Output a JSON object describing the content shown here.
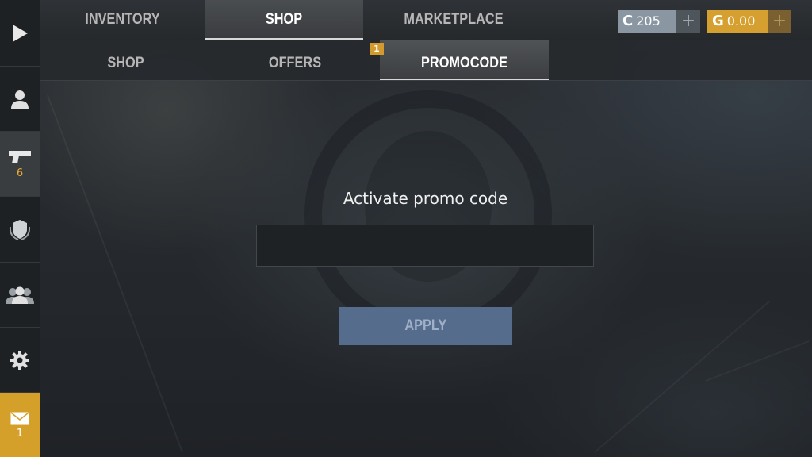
{
  "top_tabs": [
    {
      "label": "INVENTORY",
      "active": false
    },
    {
      "label": "SHOP",
      "active": true
    },
    {
      "label": "MARKETPLACE",
      "active": false
    }
  ],
  "sub_tabs": [
    {
      "label": "SHOP",
      "active": false
    },
    {
      "label": "OFFERS",
      "active": false,
      "badge": "1"
    },
    {
      "label": "PROMOCODE",
      "active": true
    }
  ],
  "currency": {
    "silver": {
      "icon": "C",
      "value": "205",
      "plus": "+"
    },
    "gold": {
      "icon": "G",
      "value": "0.00",
      "plus": "+"
    }
  },
  "sidebar": {
    "items": [
      {
        "icon": "play-icon"
      },
      {
        "icon": "profile-icon"
      },
      {
        "icon": "pistol-icon",
        "count": "6"
      },
      {
        "icon": "clan-shield-icon"
      },
      {
        "icon": "friends-icon"
      },
      {
        "icon": "gear-icon"
      },
      {
        "icon": "mail-icon",
        "count": "1"
      }
    ]
  },
  "promo": {
    "title": "Activate promo code",
    "input_value": "",
    "apply_label": "APPLY"
  },
  "colors": {
    "accent_gold": "#d4a02a",
    "apply_button": "#566c8c",
    "silver_currency": "#8a96a2"
  }
}
